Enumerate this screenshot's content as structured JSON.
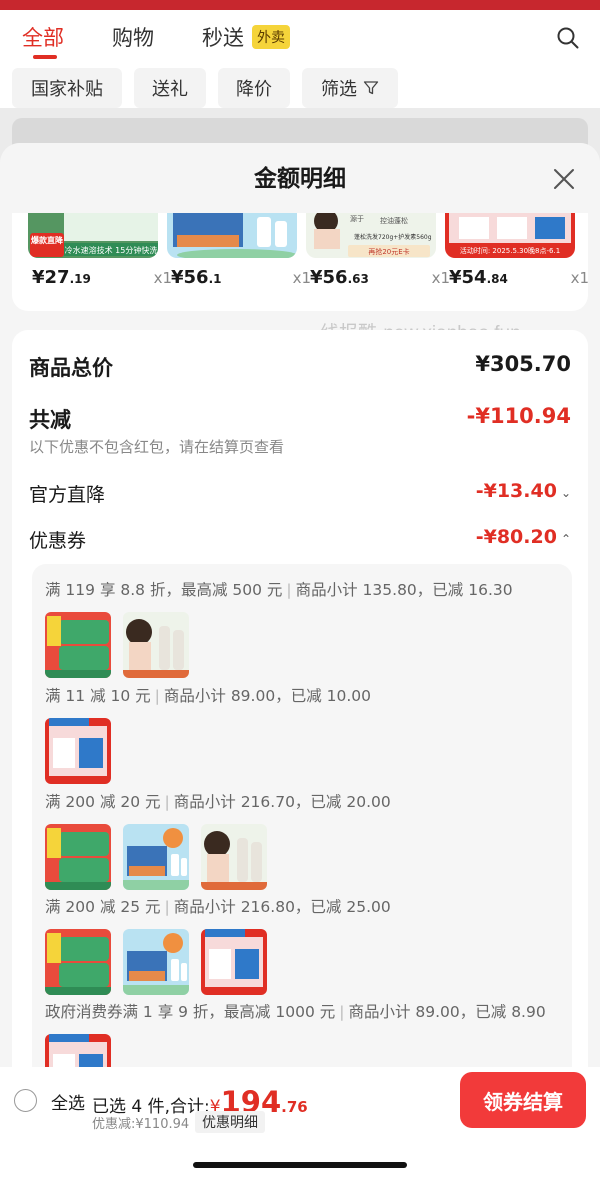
{
  "top_nav": {
    "tabs": [
      {
        "label": "全部",
        "active": true
      },
      {
        "label": "购物",
        "active": false
      },
      {
        "label": "秒送",
        "active": false
      }
    ],
    "badge": "外卖",
    "search_icon": "search-icon"
  },
  "filters": [
    "国家补贴",
    "送礼",
    "降价",
    "筛选"
  ],
  "filter_icon": "funnel-icon",
  "sheet": {
    "title": "金额明细",
    "close_icon": "close-icon"
  },
  "products": [
    {
      "price_int": "¥27",
      "price_dec": ".19",
      "qty": "x1"
    },
    {
      "price_int": "¥56",
      "price_dec": ".1",
      "qty": "x1"
    },
    {
      "price_int": "¥56",
      "price_dec": ".63",
      "qty": "x1"
    },
    {
      "price_int": "¥54",
      "price_dec": ".84",
      "qty": "x1"
    }
  ],
  "product_thumb_text": {
    "p1_badge": "爆款直降",
    "p1_banner": "冷水速溶技术 15分钟快洗",
    "p3_left": "源于",
    "p3_right": "控油蓬松",
    "p3_tag": "蓬松洗发720g+护发素560g",
    "p3_promo": "再抢20元E卡",
    "p4_text": "活动时间: 2025.5.30晚8点-6.1"
  },
  "watermark": "线报酷-new.xianbao.fun",
  "detail": {
    "total_label": "商品总价",
    "total_value": "¥305.70",
    "reduce_label": "共减",
    "reduce_value": "-¥110.94",
    "note": "以下优惠不包含红包，请在结算页查看",
    "official_label": "官方直降",
    "official_value": "-¥13.40",
    "coupon_label": "优惠券",
    "coupon_value": "-¥80.20"
  },
  "coupons": [
    {
      "rule": "满 119 享 8.8 折，最高减 500 元",
      "subtotal": "商品小计 135.80，已减 16.30"
    },
    {
      "rule": "满 11 减 10 元",
      "subtotal": "商品小计 89.00，已减 10.00"
    },
    {
      "rule": "满 200 减 20 元",
      "subtotal": "商品小计 216.70，已减 20.00"
    },
    {
      "rule": "满 200 减 25 元",
      "subtotal": "商品小计 216.80，已减 25.00"
    },
    {
      "rule": "政府消费券满 1 享 9 折，最高减 1000 元",
      "subtotal": "商品小计 89.00，已减 8.90"
    }
  ],
  "bottom": {
    "select_all": "全选",
    "selected_text": "已选 4 件,合计:",
    "currency": "¥",
    "total_int": "194",
    "total_dec": ".76",
    "discount_text": "优惠减:¥110.94",
    "detail_link": "优惠明细",
    "checkout": "领券结算"
  },
  "colors": {
    "accent": "#e02e24",
    "checkout": "#f23a3a",
    "status_bar": "#c7272e",
    "badge": "#f5d43a"
  }
}
